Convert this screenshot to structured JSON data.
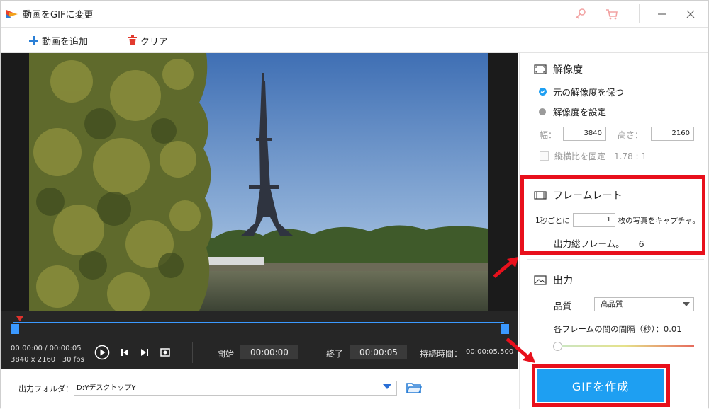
{
  "window": {
    "title": "動画をGIFに変更"
  },
  "toolbar": {
    "add_label": "動画を追加",
    "clear_label": "クリア"
  },
  "player": {
    "current_time": "00:00:00",
    "total_time": "00:00:05",
    "time_sep": " / ",
    "resolution": "3840 x 2160",
    "fps": "30 fps",
    "progress": 0.0,
    "start_label": "開始",
    "start_value": "00:00:00",
    "end_label": "終了",
    "end_value": "00:00:05",
    "duration_label": "持続時間：",
    "duration_value": "00:00:05.500"
  },
  "output_folder": {
    "label": "出力フォルダ：",
    "value": "D:¥デスクトップ¥"
  },
  "resolution_section": {
    "title": "解像度",
    "keep_original": "元の解像度を保つ",
    "set_resolution": "解像度を設定",
    "width_label": "幅：",
    "width_value": "3840",
    "height_label": "高さ：",
    "height_value": "2160",
    "lock_ratio_label": "縦横比を固定",
    "ratio_value": "1.78 : 1",
    "selected": "keep_original"
  },
  "framerate_section": {
    "title": "フレームレート",
    "prefix": "1秒ごとに",
    "frames_value": "1",
    "suffix": "枚の写真をキャプチャ。",
    "total_label": "出力総フレーム。",
    "total_value": "6"
  },
  "output_section": {
    "title": "出力",
    "quality_label": "品質",
    "quality_value": "高品質",
    "interval_label": "各フレームの間の間隔（秒）：",
    "interval_value": "0.01",
    "interval_slider_level": 0.0
  },
  "actions": {
    "make_gif": "GIFを作成"
  },
  "colors": {
    "accent": "#1e9ff2",
    "annotation": "#e8101c",
    "timeline": "#3b99ff"
  }
}
